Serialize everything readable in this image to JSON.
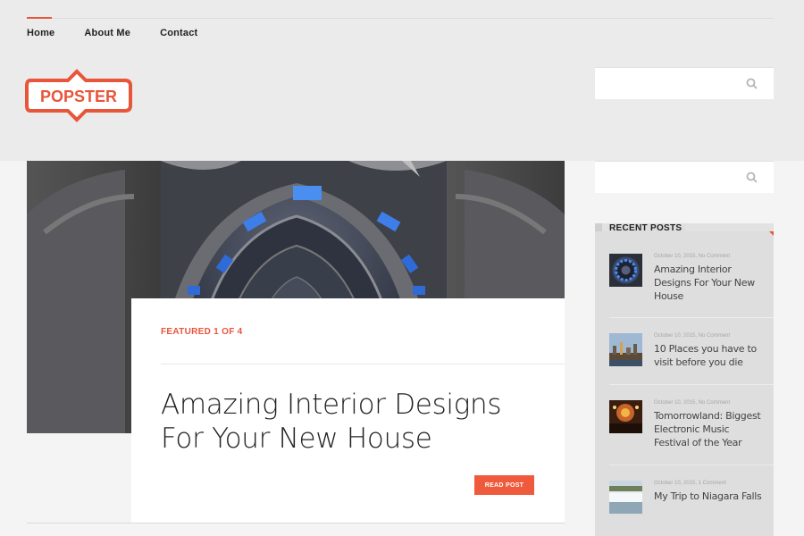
{
  "nav": {
    "items": [
      "Home",
      "About Me",
      "Contact"
    ]
  },
  "logo": {
    "text": "POPSTER",
    "color": "#e8553b"
  },
  "search": {
    "placeholder": ""
  },
  "featured": {
    "label": "FEATURED 1 OF 4",
    "title": "Amazing Interior Designs For Your New House",
    "button": "READ POST"
  },
  "recent": {
    "heading": "RECENT POSTS",
    "items": [
      {
        "date": "October 10, 2015",
        "comments": "No Comment",
        "title": "Amazing Interior Designs For Your New House",
        "thumb": "dome-thumbnail"
      },
      {
        "date": "October 10, 2015",
        "comments": "No Comment",
        "title": "10 Places you have to visit before you die",
        "thumb": "city-skyline-thumbnail"
      },
      {
        "date": "October 10, 2015",
        "comments": "No Comment",
        "title": "Tomorrowland: Biggest Electronic Music Festival of the Year",
        "thumb": "concert-thumbnail"
      },
      {
        "date": "October 10, 2015",
        "comments": "1 Comment",
        "title": "My Trip to Niagara Falls",
        "thumb": "waterfall-thumbnail"
      }
    ]
  },
  "colors": {
    "accent": "#e8553b",
    "button": "#f05a3c",
    "page_bg": "#ebebeb"
  }
}
